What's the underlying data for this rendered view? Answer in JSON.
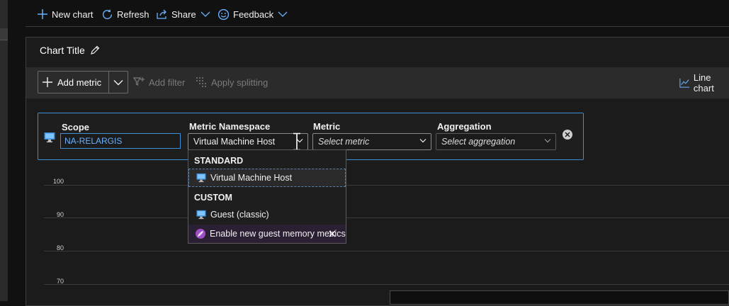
{
  "command_bar": {
    "new_chart": "New chart",
    "refresh": "Refresh",
    "share": "Share",
    "feedback": "Feedback"
  },
  "chart": {
    "title": "Chart Title"
  },
  "toolbar": {
    "add_metric": "Add metric",
    "add_filter": "Add filter",
    "apply_splitting": "Apply splitting",
    "line_chart": "Line chart"
  },
  "metric_row": {
    "scope_label": "Scope",
    "scope_value": "NA-RELARGIS",
    "namespace_label": "Metric Namespace",
    "namespace_value": "Virtual Machine Host",
    "metric_label": "Metric",
    "metric_placeholder": "Select metric",
    "aggregation_label": "Aggregation",
    "aggregation_placeholder": "Select aggregation"
  },
  "namespace_dropdown": {
    "standard_header": "STANDARD",
    "standard_items": [
      "Virtual Machine Host"
    ],
    "custom_header": "CUSTOM",
    "custom_items": [
      "Guest (classic)"
    ],
    "promo": "Enable new guest memory metrics"
  },
  "y_axis": {
    "ticks": [
      "100",
      "90",
      "80",
      "70"
    ]
  },
  "colors": {
    "accent": "#3f8fd6",
    "background": "#111111",
    "panel": "#1b1b1b",
    "toolbar": "#2b2b2b",
    "promo_icon": "#a14fc7"
  }
}
